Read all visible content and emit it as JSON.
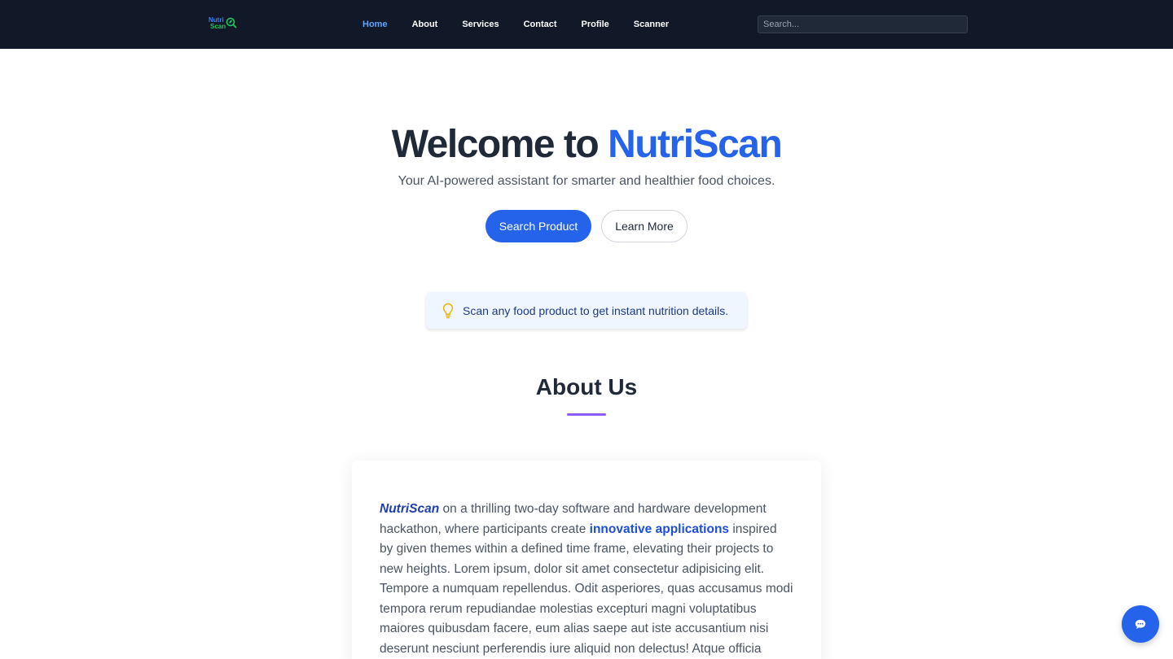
{
  "navbar": {
    "logo": {
      "line1": "Nutri",
      "line2": "Scan"
    },
    "links": [
      {
        "label": "Home",
        "active": true
      },
      {
        "label": "About",
        "active": false
      },
      {
        "label": "Services",
        "active": false
      },
      {
        "label": "Contact",
        "active": false
      },
      {
        "label": "Profile",
        "active": false
      },
      {
        "label": "Scanner",
        "active": false
      }
    ],
    "search_placeholder": "Search..."
  },
  "hero": {
    "title_prefix": "Welcome to",
    "title_brand": "NutriScan",
    "subtitle": "Your AI-powered assistant for smarter and healthier food choices.",
    "primary_button": "Search Product",
    "secondary_button": "Learn More"
  },
  "tip": {
    "icon": "lightbulb-icon",
    "text": "Scan any food product to get instant nutrition details."
  },
  "about": {
    "heading": "About Us",
    "brand": "NutriScan",
    "text_before_highlight": "on a thrilling two-day software and hardware development hackathon, where participants create",
    "highlight": "innovative applications",
    "text_after_highlight": "inspired by given themes within a defined time frame, elevating their projects to new heights. Lorem ipsum, dolor sit amet consectetur adipisicing elit. Tempore a numquam repellendus. Odit asperiores, quas accusamus modi tempora rerum repudiandae molestias excepturi magni voluptatibus maiores quibusdam facere, eum alias saepe aut iste accusantium nisi deserunt nesciunt perferendis iure aliquid non delectus! Atque officia magni eveniet"
  },
  "chat_button": {
    "icon": "chat-bubble-icon"
  },
  "colors": {
    "navbar_bg": "#111827",
    "accent": "#2563eb",
    "active_link": "#60a5fa",
    "underline": "#8b5cf6"
  }
}
